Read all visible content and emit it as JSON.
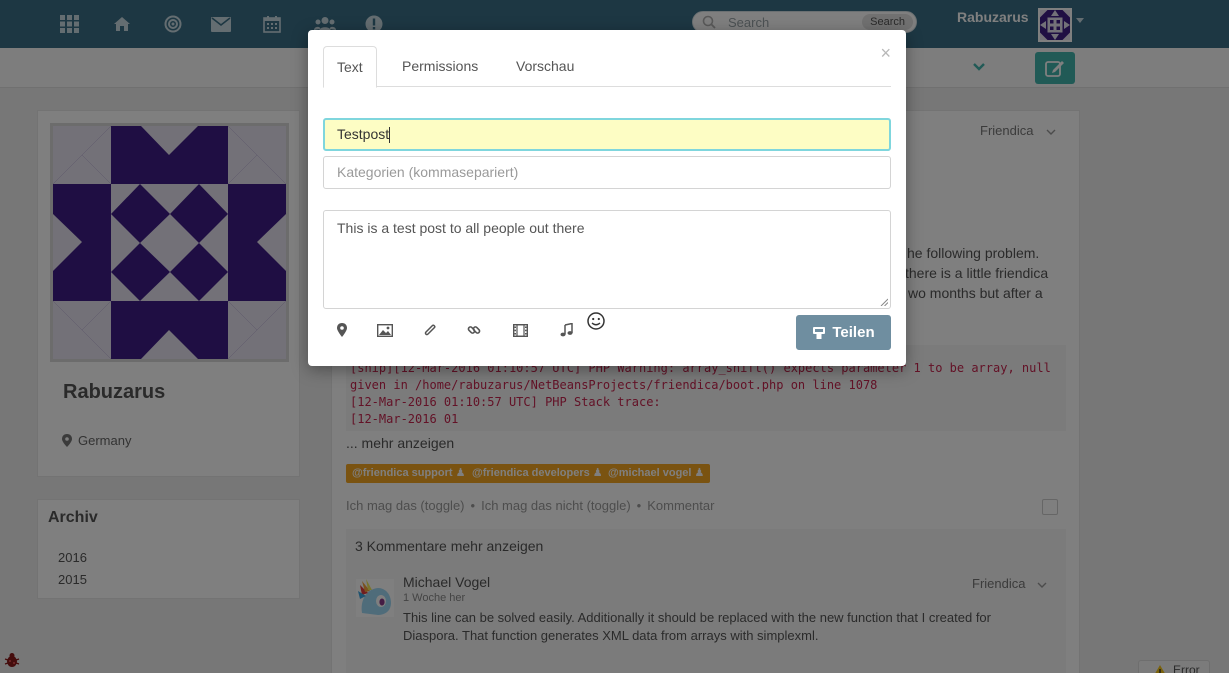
{
  "navbar": {
    "icons": [
      "grid-icon",
      "home-icon",
      "bullseye-icon",
      "envelope-icon",
      "calendar-icon",
      "users-icon",
      "exclamation-icon"
    ],
    "search": {
      "placeholder": "Search",
      "button_label": "Search"
    },
    "user_name": "Rabuzarus"
  },
  "profile": {
    "name": "Rabuzarus",
    "location": "Germany"
  },
  "archive": {
    "title": "Archiv",
    "years": [
      "2016",
      "2015"
    ]
  },
  "post": {
    "network": "Friendica",
    "text_lines": [
      "he following problem.",
      "there is a little friendica",
      "wo months but after a"
    ],
    "code_lines": [
      "[ship][12-Mar-2016 01:10:57 UTC] PHP Warning: array_shift() expects parameter 1 to be array, null",
      "given in /home/rabuzarus/NetBeansProjects/friendica/boot.php on line 1078",
      "[12-Mar-2016 01:10:57 UTC] PHP Stack trace:",
      "[12-Mar-2016 01"
    ],
    "more_label": "... mehr anzeigen",
    "tags": [
      "@friendica support",
      "@friendica developers",
      "@michael vogel"
    ],
    "like_label": "Ich mag das (toggle)",
    "dislike_label": "Ich mag das nicht (toggle)",
    "comment_label": "Kommentar",
    "comments_count_label": "3 Kommentare mehr anzeigen",
    "comment": {
      "author": "Michael Vogel",
      "time": "1 Woche her",
      "network": "Friendica",
      "text": "This line can be solved easily. Additionally it should be replaced with the new function that I created for Diaspora. That function generates XML data from arrays with simplexml."
    }
  },
  "modal": {
    "close_label": "×",
    "tabs": [
      "Text",
      "Permissions",
      "Vorschau"
    ],
    "title_value": "Testpost",
    "category_placeholder": "Kategorien (kommasepariert)",
    "body_value": "This is a test post to all people out there",
    "tools": [
      "map-marker-icon",
      "image-icon",
      "paperclip-icon",
      "link-icon",
      "film-icon",
      "music-icon",
      "smiley-icon"
    ],
    "share_label": "Teilen"
  },
  "footer": {
    "error_label": "Error"
  },
  "colors": {
    "navbar": "#3b6f86",
    "accent_teal": "#43b5ad",
    "tag_orange": "#f5a623",
    "share_button": "#6f8ea0",
    "identicon_purple": "#3e1c87"
  }
}
